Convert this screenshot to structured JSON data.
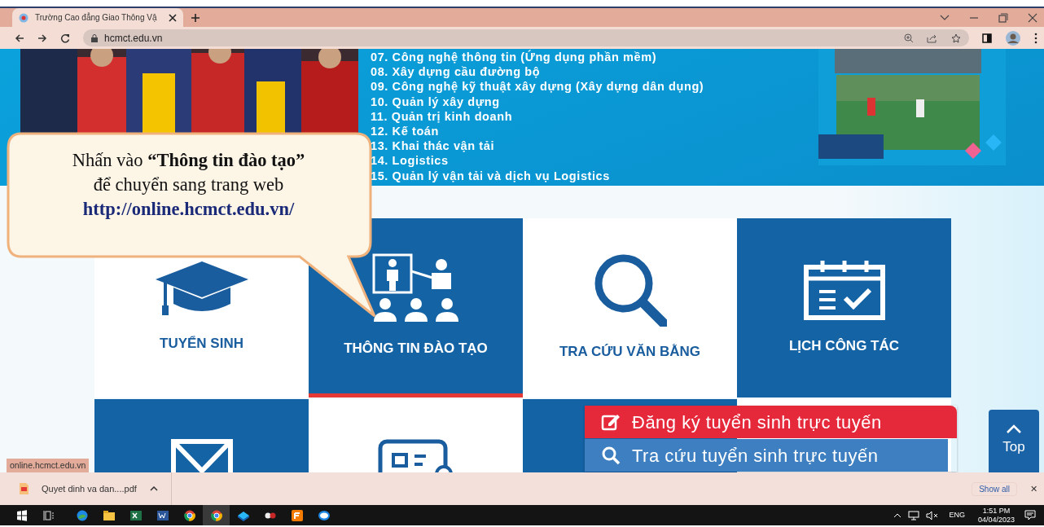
{
  "browser": {
    "tab_title": "Trường Cao đẳng Giao Thông Vậ",
    "tab_selected": true,
    "address": "hcmct.edu.vn"
  },
  "programs": [
    "07. Công nghệ thông tin (Ứng dụng phần mềm)",
    "08. Xây dựng cầu đường bộ",
    "09. Công nghệ kỹ thuật xây dựng (Xây dựng dân dụng)",
    "10. Quản lý xây dựng",
    "11. Quản trị kinh doanh",
    "12. Kế toán",
    "13. Khai thác vận tải",
    "14. Logistics",
    "15. Quản lý vận tải và dịch vụ Logistics"
  ],
  "callout": {
    "line_1": "Nhấn vào **“Thông tin đào tạo”**",
    "line_2": "để chuyển sang trang web",
    "link": "http://online.hcmct.edu.vn/"
  },
  "tiles": [
    {
      "kind": "graduation",
      "dark": false,
      "selected": false,
      "label": "TUYỂN SINH"
    },
    {
      "kind": "training",
      "dark": true,
      "selected": true,
      "label": "THÔNG TIN ĐÀO TẠO"
    },
    {
      "kind": "search",
      "dark": false,
      "selected": false,
      "label": "TRA CỨU VĂN BẰNG"
    },
    {
      "kind": "calendar",
      "dark": true,
      "selected": false,
      "label": "LỊCH CÔNG TÁC"
    },
    {
      "kind": "mail",
      "dark": true
    },
    {
      "kind": "card",
      "dark": false
    },
    {
      "kind": "blank",
      "dark": true
    },
    {
      "kind": "blank",
      "dark": false
    }
  ],
  "floating_buttons": [
    {
      "kind": "register",
      "label": "Đăng ký tuyển sinh trực tuyến"
    },
    {
      "kind": "lookup",
      "label": "Tra cứu tuyển sinh trực tuyến"
    }
  ],
  "top_button": "Top",
  "status_link": "online.hcmct.edu.vn",
  "downloads": {
    "file": "Quyet dinh va dan....pdf",
    "show_all": "Show all",
    "close": "✕"
  },
  "taskbar": {
    "language": "ENG",
    "time": "1:51 PM",
    "date": "04/04/2023"
  }
}
